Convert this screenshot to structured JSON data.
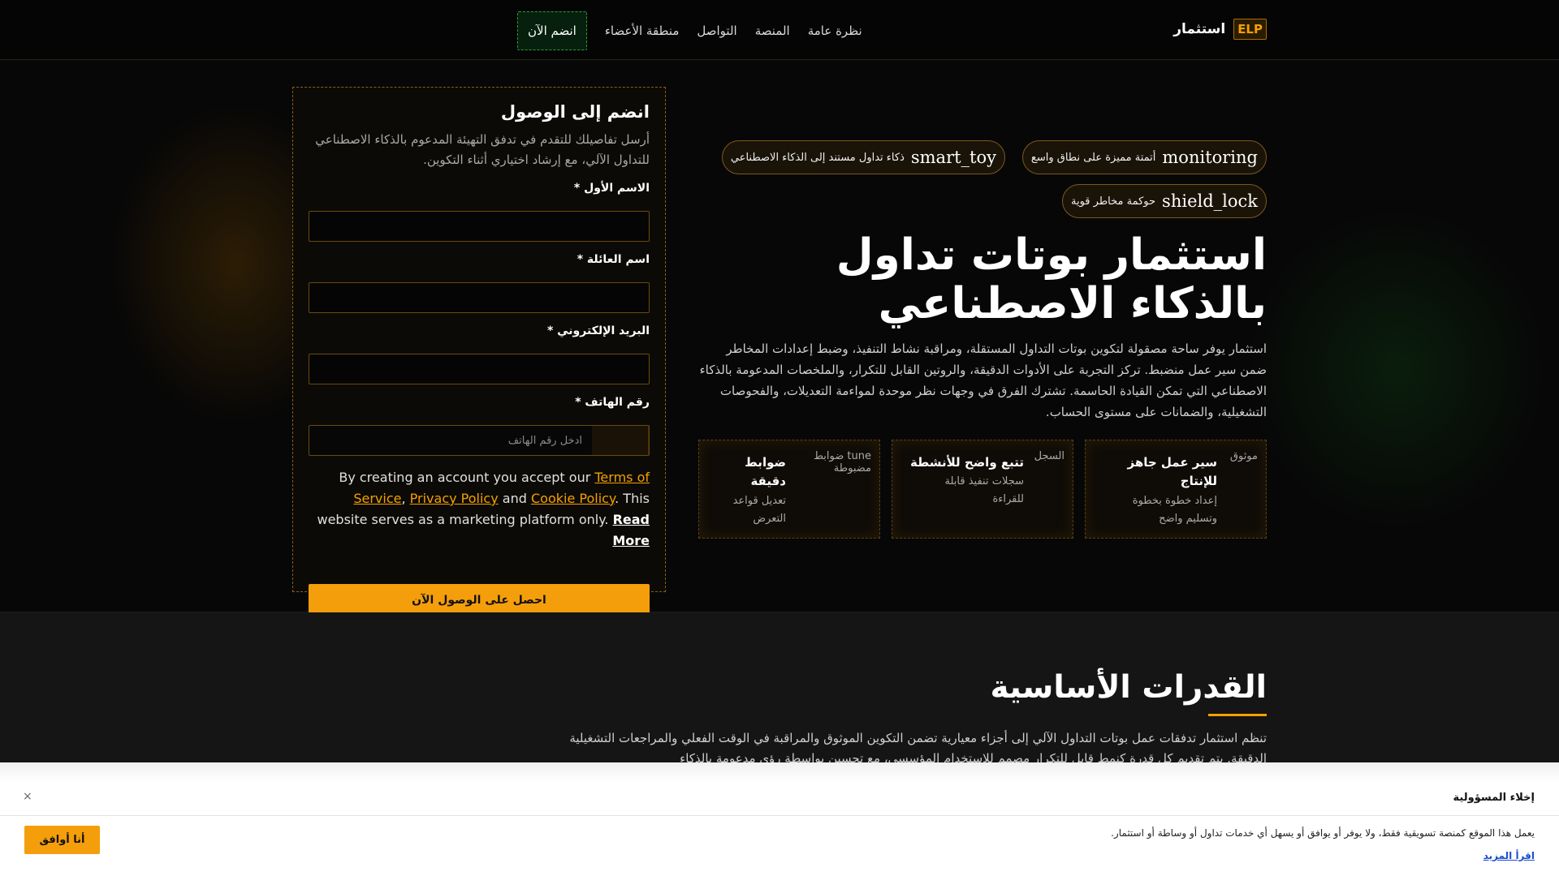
{
  "header": {
    "logo_badge": "ELP",
    "logo_text": "استثمار",
    "nav": [
      "نظرة عامة",
      "المنصة",
      "التواصل",
      "منطقة الأعضاء"
    ],
    "join_label": "انضم الآن"
  },
  "form": {
    "title": "انضم إلى الوصول",
    "description": "أرسل تفاصيلك للتقدم في تدفق التهيئة المدعوم بالذكاء الاصطناعي للتداول الآلي، مع إرشاد اختياري أثناء التكوين.",
    "first_name_label": "الاسم الأول *",
    "last_name_label": "اسم العائلة *",
    "email_label": "البريد الإلكتروني *",
    "phone_label": "رقم الهاتف *",
    "phone_placeholder": "ادخل رقم الهاتف",
    "terms_prefix": "By creating an account you accept our ",
    "terms_link": "Terms of Service",
    "comma": ", ",
    "privacy_link": "Privacy Policy",
    "and": " and ",
    "cookie_link": "Cookie Policy",
    "terms_suffix": ". This website serves as a marketing platform only. ",
    "read_more": "Read More",
    "submit_label": "احصل على الوصول الآن"
  },
  "pills": [
    {
      "icon": "monitoring",
      "text": "أتمتة مميزة على نطاق واسع"
    },
    {
      "icon": "smart_toy",
      "text": "ذكاء تداول مستند إلى الذكاء الاصطناعي"
    },
    {
      "icon": "shield_lock",
      "text": "حوكمة مخاطر قوية"
    }
  ],
  "hero": {
    "title": "استثمار بوتات تداول بالذكاء الاصطناعي",
    "description": "استثمار يوفر ساحة مصقولة لتكوين بوتات التداول المستقلة، ومراقبة نشاط التنفيذ، وضبط إعدادات المخاطر ضمن سير عمل منضبط. تركز التجربة على الأدوات الدقيقة، والروتين القابل للتكرار، والملخصات المدعومة بالذكاء الاصطناعي التي تمكن القيادة الحاسمة. تشترك الفرق في وجهات نظر موحدة لمواءمة التعديلات، والفحوصات التشغيلية، والضمانات على مستوى الحساب."
  },
  "features": [
    {
      "tag": "موثوق",
      "title": "سير عمل جاهز للإنتاج",
      "desc": "إعداد خطوة بخطوة وتسليم واضح"
    },
    {
      "tag": "السجل",
      "title": "تتبع واضح للأنشطة",
      "desc": "سجلات تنفيذ قابلة للقراءة"
    },
    {
      "tag": "tune ضوابط مضبوطة",
      "title": "ضوابط دقيقة",
      "desc": "تعديل قواعد التعرض"
    }
  ],
  "capabilities": {
    "title": "القدرات الأساسية",
    "description": "تنظم استثمار تدفقات عمل بوتات التداول الآلي إلى أجزاء معيارية تضمن التكوين الموثوق والمراقبة في الوقت الفعلي والمراجعات التشغيلية الدقيقة. يتم تقديم كل قدرة كنمط قابل للتكرار مصمم للاستخدام المؤسسي، مع تحسين بواسطة رؤى مدعومة بالذكاء"
  },
  "disclaimer": {
    "title": "إخلاء المسؤولية",
    "close": "×",
    "text": "يعمل هذا الموقع كمنصة تسويقية فقط، ولا يوفر أو يوافق أو يسهل أي خدمات تداول أو وساطة أو استثمار.",
    "read_more": "اقرأ المزيد",
    "agree_label": "أنا أوافق"
  }
}
